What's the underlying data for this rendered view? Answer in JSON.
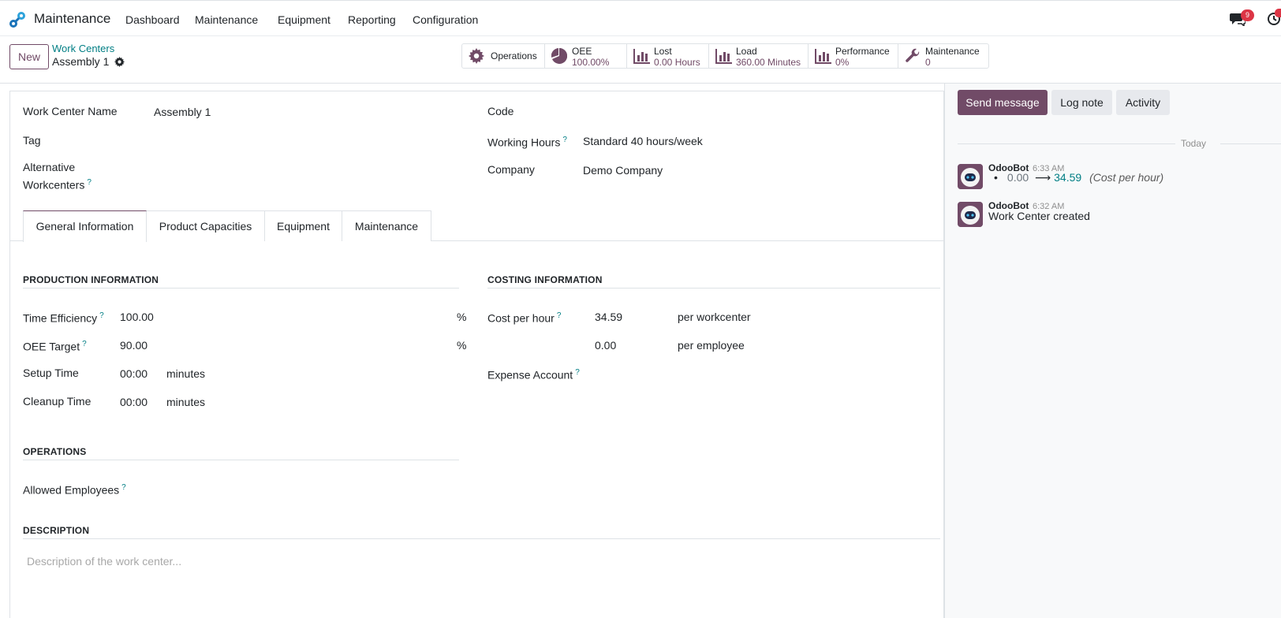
{
  "navbar": {
    "app_name": "Maintenance",
    "menu": [
      "Dashboard",
      "Maintenance",
      "Equipment",
      "Reporting",
      "Configuration"
    ],
    "chat_badge": "9"
  },
  "control_panel": {
    "new_label": "New",
    "breadcrumb_parent": "Work Centers",
    "breadcrumb_current": "Assembly 1",
    "stats": [
      {
        "label": "Operations",
        "icon": "gear-icon"
      },
      {
        "label": "OEE",
        "value": "100.00%",
        "icon": "pie-chart-icon"
      },
      {
        "label": "Lost",
        "value": "0.00 Hours",
        "icon": "bar-chart-icon"
      },
      {
        "label": "Load",
        "value": "360.00 Minutes",
        "icon": "bar-chart-icon"
      },
      {
        "label": "Performance",
        "value": "0%",
        "icon": "bar-chart-icon"
      },
      {
        "label": "Maintenance",
        "value": "0",
        "icon": "wrench-icon"
      }
    ]
  },
  "form": {
    "name_label": "Work Center Name",
    "name_value": "Assembly 1",
    "tag_label": "Tag",
    "alt_label_1": "Alternative",
    "alt_label_2": "Workcenters",
    "code_label": "Code",
    "hours_label": "Working Hours",
    "hours_value": "Standard 40 hours/week",
    "company_label": "Company",
    "company_value": "Demo Company",
    "tabs": [
      "General Information",
      "Product Capacities",
      "Equipment",
      "Maintenance"
    ],
    "production": {
      "title": "PRODUCTION INFORMATION",
      "time_eff_label": "Time Efficiency",
      "time_eff_value": "100.00",
      "oee_label": "OEE Target",
      "oee_value": "90.00",
      "percent": "%",
      "setup_label": "Setup Time",
      "setup_value": "00:00",
      "cleanup_label": "Cleanup Time",
      "cleanup_value": "00:00",
      "minutes": "minutes"
    },
    "costing": {
      "title": "COSTING INFORMATION",
      "cost_label": "Cost per hour",
      "cost_value": "34.59",
      "per_wc": "per workcenter",
      "emp_value": "0.00",
      "per_emp": "per employee",
      "expense_label": "Expense Account"
    },
    "operations": {
      "title": "OPERATIONS",
      "employees_label": "Allowed Employees"
    },
    "description": {
      "title": "DESCRIPTION",
      "placeholder": "Description of the work center..."
    }
  },
  "chatter": {
    "send_message": "Send message",
    "log_note": "Log note",
    "activity": "Activity",
    "today": "Today",
    "messages": [
      {
        "author": "OdooBot",
        "time": "6:33 AM",
        "old_value": "0.00",
        "new_value": "34.59",
        "field": "(Cost per hour)"
      },
      {
        "author": "OdooBot",
        "time": "6:32 AM",
        "body": "Work Center created"
      }
    ]
  },
  "colors": {
    "brand": "#714b67",
    "link": "#017e84",
    "badge": "#dc3545"
  }
}
